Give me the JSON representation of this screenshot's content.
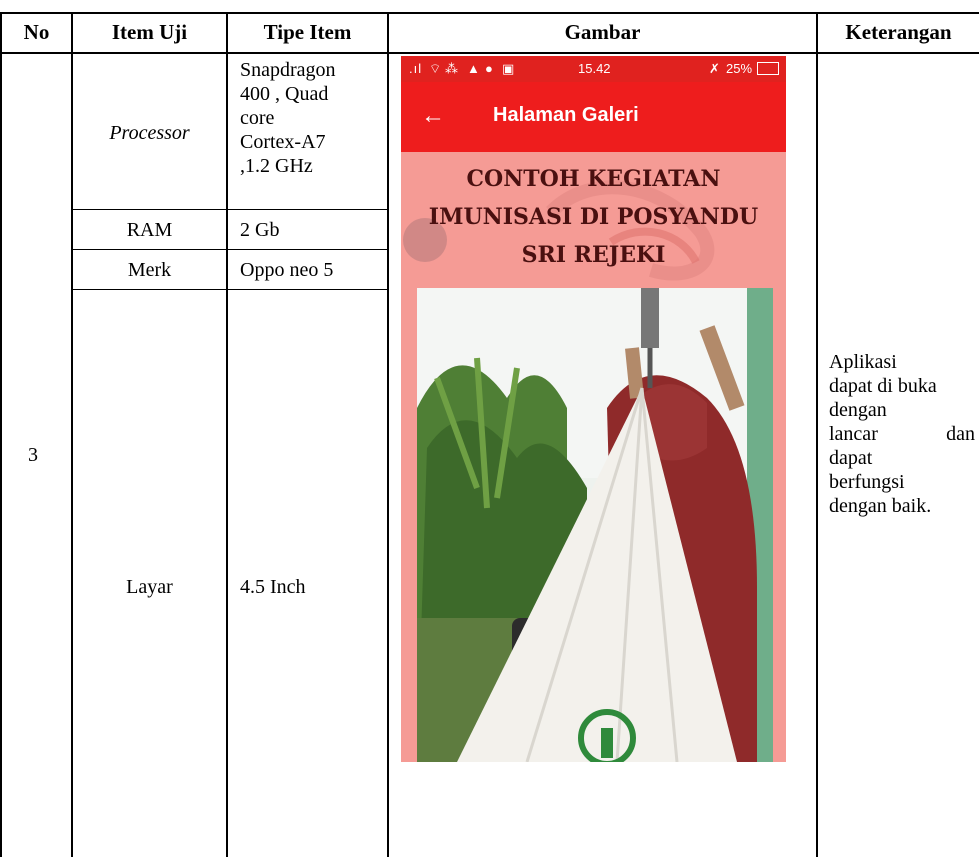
{
  "table": {
    "headers": {
      "no": "No",
      "item_uji": "Item Uji",
      "tipe_item": "Tipe Item",
      "gambar": "Gambar",
      "keterangan": "Keterangan"
    },
    "row": {
      "no": "3",
      "items": [
        {
          "item": "Processor",
          "italic": true,
          "tipe_lines": [
            "Snapdragon",
            "400 , Quad",
            "core",
            "Cortex-A7",
            ",1.2 GHz"
          ]
        },
        {
          "item": "RAM",
          "tipe_lines": [
            "2 Gb"
          ]
        },
        {
          "item": "Merk",
          "tipe_lines": [
            "Oppo neo 5"
          ]
        },
        {
          "item": "Layar",
          "tipe_lines": [
            "4.5 Inch"
          ]
        }
      ],
      "keterangan_lines": [
        "Aplikasi",
        "dapat di buka",
        "dengan",
        "lancar dan",
        "dapat",
        "berfungsi",
        "dengan baik."
      ]
    }
  },
  "phone": {
    "status_time": "15.42",
    "status_battery": "25%",
    "appbar_title": "Halaman Galeri",
    "gallery_title_lines": [
      "CONTOH KEGIATAN",
      "IMUNISASI DI POSYANDU",
      "SRI REJEKI"
    ],
    "colors": {
      "appbar": "#ee1d1d",
      "background": "#f59b95",
      "title_text": "#4a1010"
    },
    "icons": [
      "signal-icon",
      "wifi-icon",
      "warning-icon",
      "notification-icon",
      "image-icon",
      "mute-icon",
      "battery-icon",
      "back-arrow-icon"
    ]
  }
}
